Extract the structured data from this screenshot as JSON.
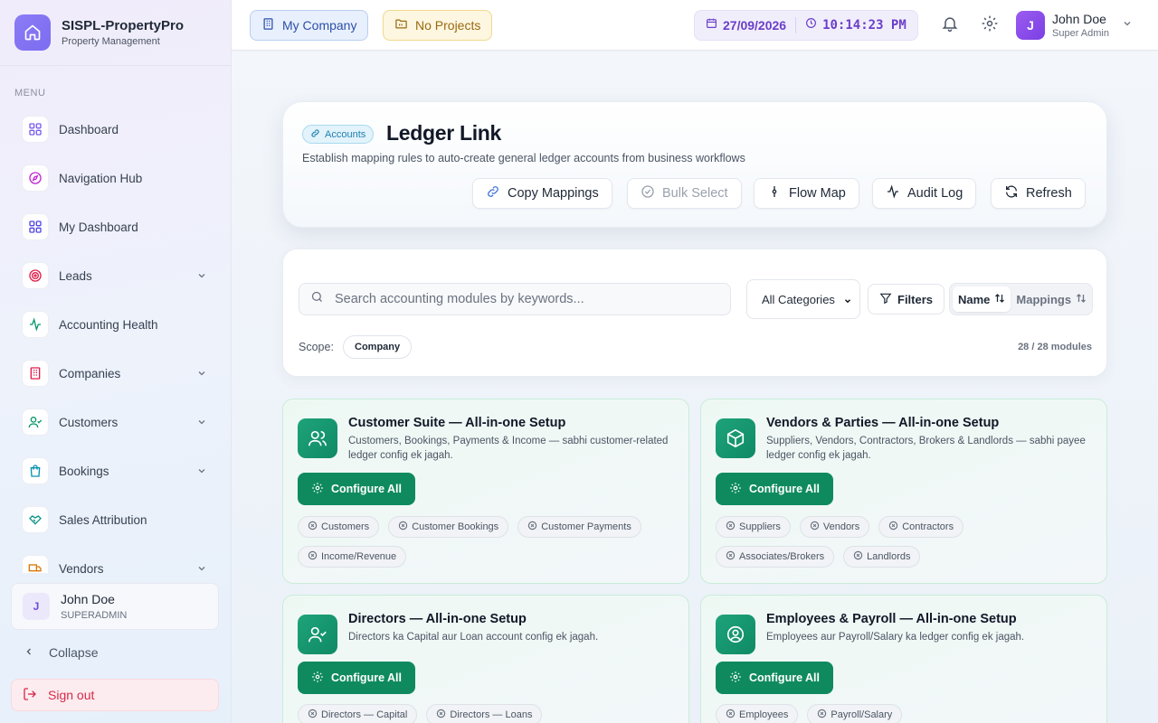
{
  "brand": {
    "title": "SISPL-PropertyPro",
    "subtitle": "Property Management"
  },
  "sidebar": {
    "menu_label": "MENU",
    "items": [
      {
        "label": "Dashboard",
        "icon": "grid-icon",
        "color": "#7a5af0",
        "has_children": false
      },
      {
        "label": "Navigation Hub",
        "icon": "compass-icon",
        "color": "#c026d3",
        "has_children": false
      },
      {
        "label": "My Dashboard",
        "icon": "grid-icon",
        "color": "#4f46e5",
        "has_children": false
      },
      {
        "label": "Leads",
        "icon": "target-icon",
        "color": "#e11d48",
        "has_children": true
      },
      {
        "label": "Accounting Health",
        "icon": "activity-icon",
        "color": "#059669",
        "has_children": false
      },
      {
        "label": "Companies",
        "icon": "building-icon",
        "color": "#e11d48",
        "has_children": true
      },
      {
        "label": "Customers",
        "icon": "user-check-icon",
        "color": "#059669",
        "has_children": true
      },
      {
        "label": "Bookings",
        "icon": "shopping-bag-icon",
        "color": "#0891b2",
        "has_children": true
      },
      {
        "label": "Sales Attribution",
        "icon": "handshake-icon",
        "color": "#0d9488",
        "has_children": false
      },
      {
        "label": "Vendors",
        "icon": "truck-icon",
        "color": "#d97706",
        "has_children": true
      }
    ],
    "user": {
      "initial": "J",
      "name": "John Doe",
      "role": "SUPERADMIN"
    },
    "collapse_label": "Collapse",
    "signout_label": "Sign out"
  },
  "topbar": {
    "company_label": "My Company",
    "projects_label": "No Projects",
    "date": "27/09/2026",
    "time": "10:14:23 PM",
    "user": {
      "initial": "J",
      "name": "John Doe",
      "role": "Super Admin"
    }
  },
  "header": {
    "badge": "Accounts",
    "title": "Ledger Link",
    "subtitle": "Establish mapping rules to auto-create general ledger accounts from business workflows",
    "buttons": {
      "copy": "Copy Mappings",
      "bulk": "Bulk Select",
      "flow": "Flow Map",
      "audit": "Audit Log",
      "refresh": "Refresh"
    }
  },
  "filters": {
    "search_placeholder": "Search accounting modules by keywords...",
    "category": "All Categories",
    "filters_label": "Filters",
    "sort_name": "Name",
    "sort_mappings": "Mappings",
    "scope_label": "Scope:",
    "scope_value": "Company",
    "count": "28 / 28 modules"
  },
  "modules": [
    {
      "title": "Customer Suite — All-in-one Setup",
      "desc": "Customers, Bookings, Payments & Income — sabhi customer-related ledger config ek jagah.",
      "button": "Configure All",
      "icon": "users-icon",
      "chips": [
        "Customers",
        "Customer Bookings",
        "Customer Payments",
        "Income/Revenue"
      ]
    },
    {
      "title": "Vendors & Parties — All-in-one Setup",
      "desc": "Suppliers, Vendors, Contractors, Brokers & Landlords — sabhi payee ledger config ek jagah.",
      "button": "Configure All",
      "icon": "box-icon",
      "chips": [
        "Suppliers",
        "Vendors",
        "Contractors",
        "Associates/Brokers",
        "Landlords"
      ]
    },
    {
      "title": "Directors — All-in-one Setup",
      "desc": "Directors ka Capital aur Loan account config ek jagah.",
      "button": "Configure All",
      "icon": "user-check-icon",
      "chips": [
        "Directors — Capital",
        "Directors — Loans"
      ]
    },
    {
      "title": "Employees & Payroll — All-in-one Setup",
      "desc": "Employees aur Payroll/Salary ka ledger config ek jagah.",
      "button": "Configure All",
      "icon": "user-circle-icon",
      "chips": [
        "Employees",
        "Payroll/Salary"
      ]
    }
  ]
}
